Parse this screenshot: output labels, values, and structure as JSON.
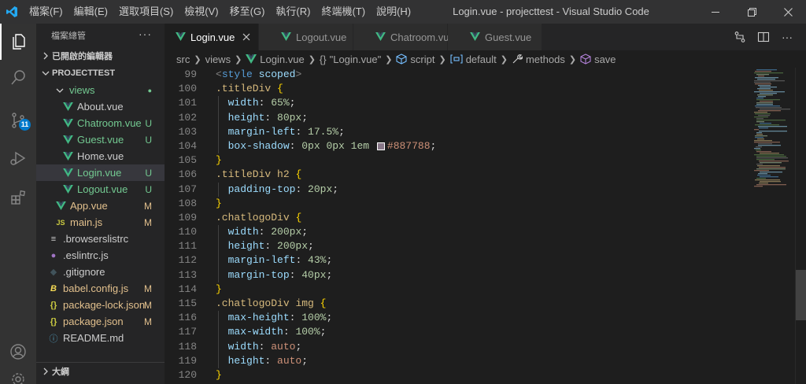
{
  "titlebar": {
    "menus": [
      "檔案(F)",
      "編輯(E)",
      "選取項目(S)",
      "檢視(V)",
      "移至(G)",
      "執行(R)",
      "終端機(T)",
      "說明(H)"
    ],
    "window_title": "Login.vue - projecttest - Visual Studio Code"
  },
  "activity": {
    "scm_badge": "11"
  },
  "sidebar": {
    "title": "檔案總管",
    "more": "···",
    "open_editors": "已開啟的編輯器",
    "project": "PROJECTTEST",
    "outline": "大綱",
    "tree": [
      {
        "label": "views",
        "status": "●",
        "icon": "folder",
        "kind": "folder"
      },
      {
        "label": "About.vue",
        "status": "",
        "icon": "vue",
        "kind": "vue-plain"
      },
      {
        "label": "Chatroom.vue",
        "status": "U",
        "icon": "vue",
        "kind": "vue-untracked"
      },
      {
        "label": "Guest.vue",
        "status": "U",
        "icon": "vue",
        "kind": "vue-untracked"
      },
      {
        "label": "Home.vue",
        "status": "",
        "icon": "vue",
        "kind": "vue-plain"
      },
      {
        "label": "Login.vue",
        "status": "U",
        "icon": "vue",
        "kind": "vue-untracked-selected"
      },
      {
        "label": "Logout.vue",
        "status": "U",
        "icon": "vue",
        "kind": "vue-untracked"
      },
      {
        "label": "App.vue",
        "status": "M",
        "icon": "vue",
        "kind": "modified"
      },
      {
        "label": "main.js",
        "status": "M",
        "icon": "JS",
        "kind": "modified"
      },
      {
        "label": ".browserslistrc",
        "status": "",
        "icon": "≡",
        "kind": "plain"
      },
      {
        "label": ".eslintrc.js",
        "status": "",
        "icon": "●",
        "kind": "plain"
      },
      {
        "label": ".gitignore",
        "status": "",
        "icon": "◆",
        "kind": "plain"
      },
      {
        "label": "babel.config.js",
        "status": "M",
        "icon": "B",
        "kind": "modified"
      },
      {
        "label": "package-lock.json",
        "status": "M",
        "icon": "{}",
        "kind": "modified"
      },
      {
        "label": "package.json",
        "status": "M",
        "icon": "{}",
        "kind": "modified"
      },
      {
        "label": "README.md",
        "status": "",
        "icon": "ⓘ",
        "kind": "plain"
      }
    ]
  },
  "tabs": [
    {
      "label": "Login.vue",
      "active": true
    },
    {
      "label": "Logout.vue",
      "active": false
    },
    {
      "label": "Chatroom.vue",
      "active": false
    },
    {
      "label": "Guest.vue",
      "active": false
    }
  ],
  "breadcrumbs": {
    "src": "src",
    "views": "views",
    "file": "Login.vue",
    "braces": "{}",
    "module": "\"Login.vue\"",
    "script": "script",
    "default": "default",
    "methods": "methods",
    "save": "save"
  },
  "colors": {
    "vue_green": "#41b883",
    "swatch": "#887788",
    "accent": "#007acc"
  },
  "code": [
    {
      "n": "99",
      "tokens": [
        [
          "t-tag",
          "<"
        ],
        [
          "t-tagname",
          "style"
        ],
        [
          "t-punc",
          " "
        ],
        [
          "t-attr",
          "scoped"
        ],
        [
          "t-tag",
          ">"
        ]
      ]
    },
    {
      "n": "100",
      "tokens": [
        [
          "t-sel",
          ".titleDiv"
        ],
        [
          "t-punc",
          " "
        ],
        [
          "t-brace",
          "{"
        ]
      ]
    },
    {
      "n": "101",
      "guide": true,
      "tokens": [
        [
          "t-punc",
          "  "
        ],
        [
          "t-prop",
          "width"
        ],
        [
          "t-punc",
          ": "
        ],
        [
          "t-num",
          "65%"
        ],
        [
          "t-punc",
          ";"
        ]
      ]
    },
    {
      "n": "102",
      "guide": true,
      "tokens": [
        [
          "t-punc",
          "  "
        ],
        [
          "t-prop",
          "height"
        ],
        [
          "t-punc",
          ": "
        ],
        [
          "t-num",
          "80px"
        ],
        [
          "t-punc",
          ";"
        ]
      ]
    },
    {
      "n": "103",
      "guide": true,
      "tokens": [
        [
          "t-punc",
          "  "
        ],
        [
          "t-prop",
          "margin-left"
        ],
        [
          "t-punc",
          ": "
        ],
        [
          "t-num",
          "17.5%"
        ],
        [
          "t-punc",
          ";"
        ]
      ]
    },
    {
      "n": "104",
      "guide": true,
      "tokens": [
        [
          "t-punc",
          "  "
        ],
        [
          "t-prop",
          "box-shadow"
        ],
        [
          "t-punc",
          ": "
        ],
        [
          "t-num",
          "0px"
        ],
        [
          "t-punc",
          " "
        ],
        [
          "t-num",
          "0px"
        ],
        [
          "t-punc",
          " "
        ],
        [
          "t-num",
          "1em"
        ],
        [
          "t-punc",
          " "
        ],
        [
          "swatch",
          ""
        ],
        [
          "t-val",
          "#887788"
        ],
        [
          "t-punc",
          ";"
        ]
      ]
    },
    {
      "n": "105",
      "tokens": [
        [
          "t-brace",
          "}"
        ]
      ]
    },
    {
      "n": "106",
      "tokens": [
        [
          "t-sel",
          ".titleDiv"
        ],
        [
          "t-punc",
          " "
        ],
        [
          "t-sel",
          "h2"
        ],
        [
          "t-punc",
          " "
        ],
        [
          "t-brace",
          "{"
        ]
      ]
    },
    {
      "n": "107",
      "guide": true,
      "tokens": [
        [
          "t-punc",
          "  "
        ],
        [
          "t-prop",
          "padding-top"
        ],
        [
          "t-punc",
          ": "
        ],
        [
          "t-num",
          "20px"
        ],
        [
          "t-punc",
          ";"
        ]
      ]
    },
    {
      "n": "108",
      "tokens": [
        [
          "t-brace",
          "}"
        ]
      ]
    },
    {
      "n": "109",
      "tokens": [
        [
          "t-sel",
          ".chatlogoDiv"
        ],
        [
          "t-punc",
          " "
        ],
        [
          "t-brace",
          "{"
        ]
      ]
    },
    {
      "n": "110",
      "guide": true,
      "tokens": [
        [
          "t-punc",
          "  "
        ],
        [
          "t-prop",
          "width"
        ],
        [
          "t-punc",
          ": "
        ],
        [
          "t-num",
          "200px"
        ],
        [
          "t-punc",
          ";"
        ]
      ]
    },
    {
      "n": "111",
      "guide": true,
      "tokens": [
        [
          "t-punc",
          "  "
        ],
        [
          "t-prop",
          "height"
        ],
        [
          "t-punc",
          ": "
        ],
        [
          "t-num",
          "200px"
        ],
        [
          "t-punc",
          ";"
        ]
      ]
    },
    {
      "n": "112",
      "guide": true,
      "tokens": [
        [
          "t-punc",
          "  "
        ],
        [
          "t-prop",
          "margin-left"
        ],
        [
          "t-punc",
          ": "
        ],
        [
          "t-num",
          "43%"
        ],
        [
          "t-punc",
          ";"
        ]
      ]
    },
    {
      "n": "113",
      "guide": true,
      "tokens": [
        [
          "t-punc",
          "  "
        ],
        [
          "t-prop",
          "margin-top"
        ],
        [
          "t-punc",
          ": "
        ],
        [
          "t-num",
          "40px"
        ],
        [
          "t-punc",
          ";"
        ]
      ]
    },
    {
      "n": "114",
      "tokens": [
        [
          "t-brace",
          "}"
        ]
      ]
    },
    {
      "n": "115",
      "tokens": [
        [
          "t-sel",
          ".chatlogoDiv"
        ],
        [
          "t-punc",
          " "
        ],
        [
          "t-sel",
          "img"
        ],
        [
          "t-punc",
          " "
        ],
        [
          "t-brace",
          "{"
        ]
      ]
    },
    {
      "n": "116",
      "guide": true,
      "tokens": [
        [
          "t-punc",
          "  "
        ],
        [
          "t-prop",
          "max-height"
        ],
        [
          "t-punc",
          ": "
        ],
        [
          "t-num",
          "100%"
        ],
        [
          "t-punc",
          ";"
        ]
      ]
    },
    {
      "n": "117",
      "guide": true,
      "tokens": [
        [
          "t-punc",
          "  "
        ],
        [
          "t-prop",
          "max-width"
        ],
        [
          "t-punc",
          ": "
        ],
        [
          "t-num",
          "100%"
        ],
        [
          "t-punc",
          ";"
        ]
      ]
    },
    {
      "n": "118",
      "guide": true,
      "tokens": [
        [
          "t-punc",
          "  "
        ],
        [
          "t-prop",
          "width"
        ],
        [
          "t-punc",
          ": "
        ],
        [
          "t-val",
          "auto"
        ],
        [
          "t-punc",
          ";"
        ]
      ]
    },
    {
      "n": "119",
      "guide": true,
      "tokens": [
        [
          "t-punc",
          "  "
        ],
        [
          "t-prop",
          "height"
        ],
        [
          "t-punc",
          ": "
        ],
        [
          "t-val",
          "auto"
        ],
        [
          "t-punc",
          ";"
        ]
      ]
    },
    {
      "n": "120",
      "tokens": [
        [
          "t-brace",
          "}"
        ]
      ]
    }
  ]
}
